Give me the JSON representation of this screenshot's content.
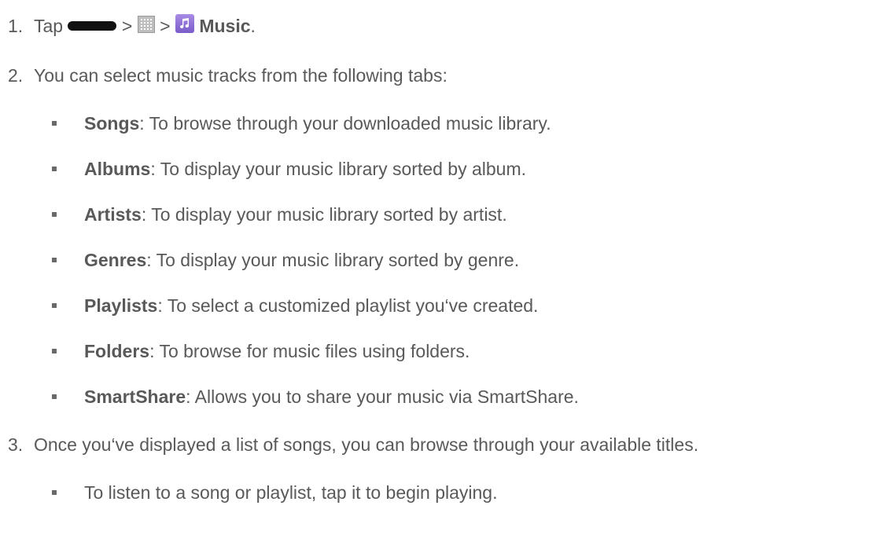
{
  "steps": [
    {
      "number": "1.",
      "tap_text": "Tap",
      "sep1": ">",
      "sep2": ">",
      "app_name": "Music",
      "end_period": "."
    },
    {
      "number": "2.",
      "text": "You can select music tracks from the following tabs:",
      "tabs": [
        {
          "name": "Songs",
          "desc": ": To browse through your downloaded music library."
        },
        {
          "name": "Albums",
          "desc": ": To display your music library sorted by album."
        },
        {
          "name": "Artists",
          "desc": ": To display your music library sorted by artist."
        },
        {
          "name": "Genres",
          "desc": ": To display your music library sorted by genre."
        },
        {
          "name": "Playlists",
          "desc": ": To select a customized playlist you‘ve created."
        },
        {
          "name": "Folders",
          "desc": ": To browse for music files using folders."
        },
        {
          "name": "SmartShare",
          "desc": ": Allows you to share your music via SmartShare."
        }
      ]
    },
    {
      "number": "3.",
      "text": "Once you‘ve displayed a list of songs, you can browse through your available titles.",
      "bullets": [
        "To listen to a song or playlist, tap it to begin playing."
      ]
    }
  ],
  "icons": {
    "home_button": "home-button-icon",
    "apps": "apps-grid-icon",
    "music": "music-app-icon"
  },
  "colors": {
    "text": "#595959",
    "music_icon": "#8e6fd8"
  }
}
